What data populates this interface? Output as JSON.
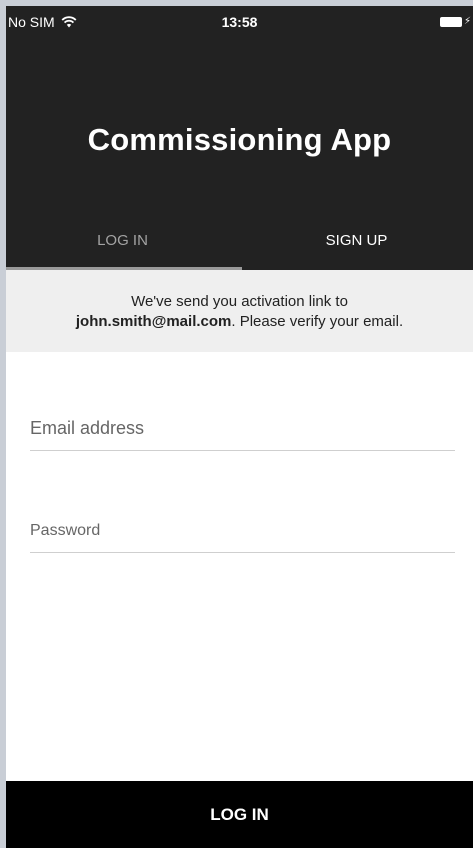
{
  "status_bar": {
    "carrier": "No SIM",
    "time": "13:58",
    "icons": [
      "wifi-icon",
      "battery-icon",
      "charging-bolt-icon"
    ]
  },
  "header": {
    "title": "Commissioning App",
    "background_color": "#222222"
  },
  "tabs": [
    {
      "label": "LOG IN",
      "selected": true
    },
    {
      "label": "SIGN UP",
      "selected": false
    }
  ],
  "notice": {
    "line1": "We've send you activation link to",
    "email": "john.smith@mail.com",
    "line2_rest": ". Please verify your email."
  },
  "form": {
    "email_placeholder": "Email address",
    "email_value": "",
    "password_placeholder": "Password",
    "password_value": ""
  },
  "footer": {
    "login_label": "LOG IN",
    "background_color": "#000000"
  }
}
